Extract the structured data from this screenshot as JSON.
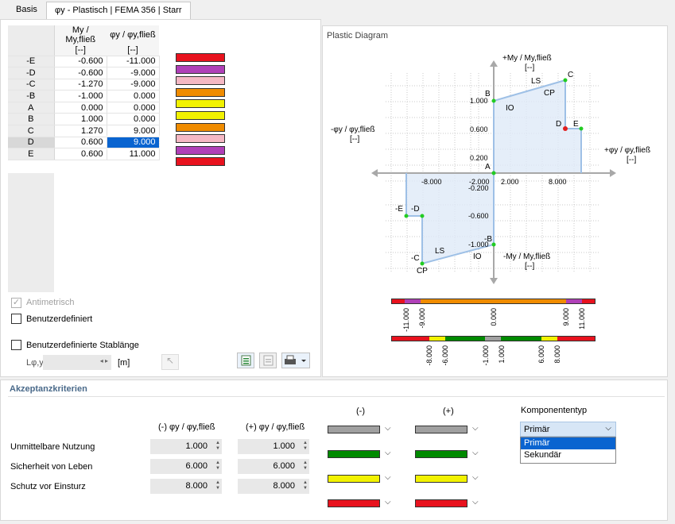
{
  "tabs": [
    {
      "label": "Basis"
    },
    {
      "label": "φy - Plastisch | FEMA 356 | Starr"
    }
  ],
  "table": {
    "col1_header": "My / My,fließ",
    "col2_header": "φy / φy,fließ",
    "unit": "[--]",
    "rows": [
      {
        "label": "-E",
        "m": "-0.600",
        "phi": "-11.000",
        "color": "#e8121e"
      },
      {
        "label": "-D",
        "m": "-0.600",
        "phi": "-9.000",
        "color": "#b040b8"
      },
      {
        "label": "-C",
        "m": "-1.270",
        "phi": "-9.000",
        "color": "#f5b8c4"
      },
      {
        "label": "-B",
        "m": "-1.000",
        "phi": "0.000",
        "color": "#f08c00"
      },
      {
        "label": "A",
        "m": "0.000",
        "phi": "0.000",
        "color": "#f2f200"
      },
      {
        "label": "B",
        "m": "1.000",
        "phi": "0.000",
        "color": "#f2f200"
      },
      {
        "label": "C",
        "m": "1.270",
        "phi": "9.000",
        "color": "#f08c00"
      },
      {
        "label": "D",
        "m": "0.600",
        "phi": "9.000",
        "color": "#f5b8c4"
      },
      {
        "label": "E",
        "m": "0.600",
        "phi": "11.000",
        "color": "#b040b8"
      },
      {
        "label": "",
        "m": "",
        "phi": "",
        "color": "#e8121e"
      }
    ],
    "selected_row": "D"
  },
  "options": {
    "antimetrisch": "Antimetrisch",
    "benutzerdefiniert": "Benutzerdefiniert",
    "stablaenge": "Benutzerdefinierte Stablänge",
    "lphi_label": "Lφ,y",
    "lphi_unit": "[m]"
  },
  "diagram": {
    "title": "Plastic Diagram",
    "y_pos_label": "+My / My,fließ",
    "y_neg_label": "-My / My,fließ",
    "x_pos_label": "+φy / φy,fließ",
    "x_neg_label": "-φy / φy,fließ",
    "unit": "[--]",
    "x_ticks": [
      "-8.000",
      "-2.000",
      "2.000",
      "8.000"
    ],
    "y_ticks": [
      "1.000",
      "0.600",
      "0.200",
      "-0.200",
      "-0.600",
      "-1.000"
    ],
    "points": [
      "A",
      "B",
      "C",
      "D",
      "E",
      "-B",
      "-C",
      "-D",
      "-E"
    ],
    "zone_labels": {
      "io": "IO",
      "ls": "LS",
      "cp": "CP"
    }
  },
  "scale_bar1": {
    "labels": [
      "-11.000",
      "-9.000",
      "0.000",
      "9.000",
      "11.000"
    ]
  },
  "scale_bar2": {
    "labels": [
      "-8.000",
      "-6.000",
      "-1.000",
      "1.000",
      "6.000",
      "8.000"
    ]
  },
  "criteria": {
    "title": "Akzeptanzkriterien",
    "neg_header": "(-) φy / φy,fließ",
    "pos_header": "(+) φy / φy,fließ",
    "neg_col": "(-)",
    "pos_col": "(+)",
    "komponententyp": "Komponententyp",
    "rows": [
      {
        "label": "Unmittelbare Nutzung",
        "neg": "1.000",
        "pos": "1.000"
      },
      {
        "label": "Sicherheit von Leben",
        "neg": "6.000",
        "pos": "6.000"
      },
      {
        "label": "Schutz vor Einsturz",
        "neg": "8.000",
        "pos": "8.000"
      }
    ],
    "color_rows": [
      "#a0a0a0",
      "#008a00",
      "#f2f200",
      "#e8121e"
    ],
    "dropdown_value": "Primär",
    "dropdown_options": [
      "Primär",
      "Sekundär"
    ]
  }
}
